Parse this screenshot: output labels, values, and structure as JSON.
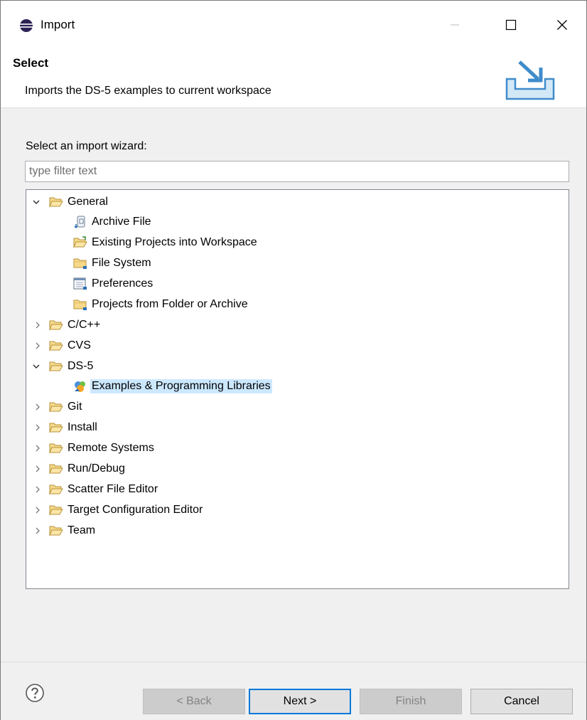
{
  "window": {
    "title": "Import"
  },
  "header": {
    "title": "Select",
    "description": "Imports the DS-5 examples to current workspace"
  },
  "wizard": {
    "label": "Select an import wizard:",
    "filter_placeholder": "type filter text"
  },
  "tree": {
    "general": {
      "label": "General",
      "children": {
        "archive_file": "Archive File",
        "existing_projects": "Existing Projects into Workspace",
        "file_system": "File System",
        "preferences": "Preferences",
        "projects_from_folder": "Projects from Folder or Archive"
      }
    },
    "cpp": {
      "label": "C/C++"
    },
    "cvs": {
      "label": "CVS"
    },
    "ds5": {
      "label": "DS-5",
      "children": {
        "examples": "Examples & Programming Libraries"
      }
    },
    "git": {
      "label": "Git"
    },
    "install": {
      "label": "Install"
    },
    "remote_systems": {
      "label": "Remote Systems"
    },
    "run_debug": {
      "label": "Run/Debug"
    },
    "scatter": {
      "label": "Scatter File Editor"
    },
    "target_config": {
      "label": "Target Configuration Editor"
    },
    "team": {
      "label": "Team"
    }
  },
  "buttons": {
    "back": "< Back",
    "next": "Next >",
    "finish": "Finish",
    "cancel": "Cancel"
  },
  "colors": {
    "selection": "#cce8ff",
    "default_button_border": "#0078d7",
    "folder": "#dcb35c"
  }
}
